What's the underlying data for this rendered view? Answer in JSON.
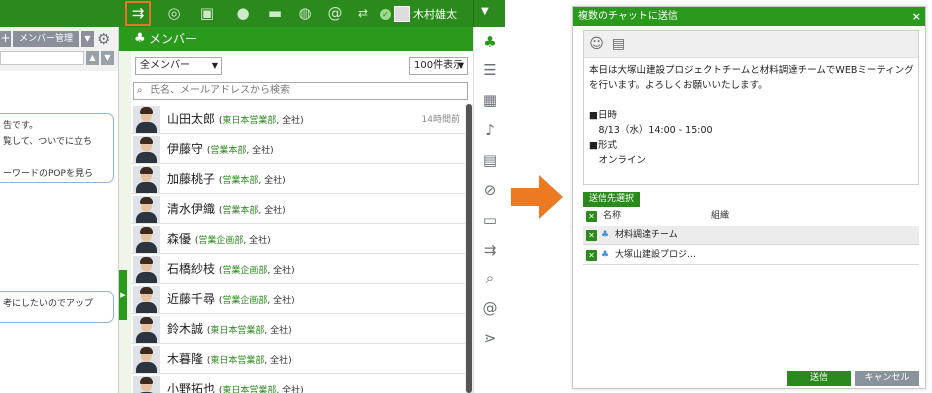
{
  "topbar": {
    "user_name": "木村雄太",
    "icons": [
      "chat-forward-icon",
      "chat-bubble-icon",
      "clipboard-icon",
      "person-icon",
      "comment-icon",
      "globe-icon",
      "at-icon",
      "swap-icon"
    ]
  },
  "chat_pane": {
    "manage_button": "メンバー管理",
    "add_button": "+",
    "messages": [
      "告です。\n覧して、ついでに立ち\n\nーワードのPOPを見ら",
      "考にしたいのでアップ"
    ]
  },
  "member_panel": {
    "title": "メンバー",
    "filter_select": "全メンバー",
    "page_size_select": "100件表示",
    "search_placeholder": "氏名、メールアドレスから検索",
    "members": [
      {
        "name": "山田太郎",
        "dept": "東日本営業部",
        "org": "全社",
        "when": "14時間前"
      },
      {
        "name": "伊藤守",
        "dept": "営業本部",
        "org": "全社",
        "when": ""
      },
      {
        "name": "加藤桃子",
        "dept": "営業本部",
        "org": "全社",
        "when": ""
      },
      {
        "name": "清水伊織",
        "dept": "営業本部",
        "org": "全社",
        "when": ""
      },
      {
        "name": "森優",
        "dept": "営業企画部",
        "org": "全社",
        "when": ""
      },
      {
        "name": "石橋紗枝",
        "dept": "営業企画部",
        "org": "全社",
        "when": ""
      },
      {
        "name": "近藤千尋",
        "dept": "営業企画部",
        "org": "全社",
        "when": ""
      },
      {
        "name": "鈴木誠",
        "dept": "東日本営業部",
        "org": "全社",
        "when": ""
      },
      {
        "name": "木暮隆",
        "dept": "東日本営業部",
        "org": "全社",
        "when": ""
      },
      {
        "name": "小野拓也",
        "dept": "東日本営業部",
        "org": "全社",
        "when": ""
      }
    ]
  },
  "rail_icons": [
    "members-icon",
    "list-icon",
    "calendar-icon",
    "bell-icon",
    "board-icon",
    "paperclip-icon",
    "message-icon",
    "forward-icon",
    "search-icon",
    "at-icon",
    "filter-icon"
  ],
  "dialog": {
    "title": "複数のチャットに送信",
    "close": "×",
    "message": "本日は大塚山建設プロジェクトチームと材料調達チームでWEBミーティングを行います。よろしくお願いいたします。\n\n■日時\n　8/13（水）14:00 - 15:00\n■形式\n　オンライン",
    "pick_button": "送信先選択",
    "col_name": "名称",
    "col_org": "組織",
    "targets": [
      "材料調達チーム",
      "大塚山建設プロジ…"
    ],
    "send_button": "送信",
    "cancel_button": "キャンセル"
  },
  "colors": {
    "brand_green": "#2a9a1c",
    "highlight_orange": "#e8742a",
    "arrow_orange": "#ec7a22"
  }
}
